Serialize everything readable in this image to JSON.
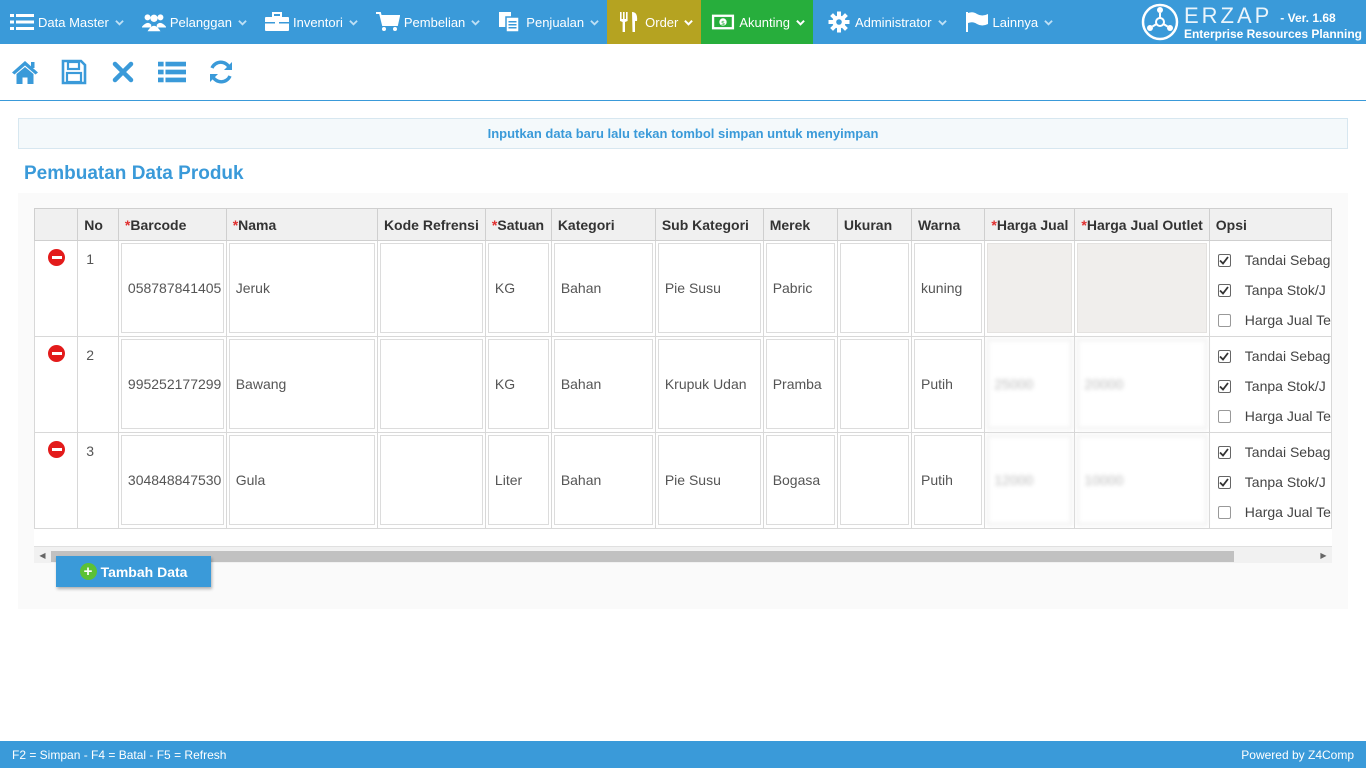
{
  "nav": {
    "items": [
      {
        "label": "Data Master",
        "icon": "list-icon"
      },
      {
        "label": "Pelanggan",
        "icon": "users-icon"
      },
      {
        "label": "Inventori",
        "icon": "briefcase-icon"
      },
      {
        "label": "Pembelian",
        "icon": "cart-icon"
      },
      {
        "label": "Penjualan",
        "icon": "documents-icon"
      },
      {
        "label": "Order",
        "icon": "utensils-icon"
      },
      {
        "label": "Akunting",
        "icon": "money-icon"
      },
      {
        "label": "Administrator",
        "icon": "gear-icon"
      },
      {
        "label": "Lainnya",
        "icon": "flag-icon"
      }
    ],
    "colors": {
      "bar": "#3a9ad9",
      "order": "#b5a321",
      "akunting": "#27ae3c"
    }
  },
  "brand": {
    "name": "ERZAP",
    "version": "- Ver. 1.68",
    "subtitle": "Enterprise Resources Planning"
  },
  "toolbar": {
    "buttons": [
      "home-icon",
      "save-icon",
      "close-icon",
      "list-icon",
      "refresh-icon"
    ]
  },
  "notice": "Inputkan data baru lalu tekan tombol simpan untuk menyimpan",
  "page_title": "Pembuatan Data Produk",
  "table": {
    "headers": {
      "no": "No",
      "barcode": "Barcode",
      "nama": "Nama",
      "kode_referensi": "Kode Refrensi",
      "satuan": "Satuan",
      "kategori": "Kategori",
      "sub_kategori": "Sub Kategori",
      "merek": "Merek",
      "ukuran": "Ukuran",
      "warna": "Warna",
      "harga_jual": "Harga Jual",
      "harga_jual_outlet": "Harga Jual Outlet",
      "opsi": "Opsi"
    },
    "required_mark": "*",
    "rows": [
      {
        "no": "1",
        "barcode": "058787841405",
        "nama": "Jeruk",
        "kode_referensi": "",
        "satuan": "KG",
        "kategori": "Bahan",
        "sub_kategori": "Pie Susu",
        "merek": "Pabric",
        "ukuran": "",
        "warna": "kuning",
        "harga_jual": "",
        "harga_jual_outlet": "",
        "opsi": [
          {
            "label": "Tandai Sebag",
            "checked": true
          },
          {
            "label": "Tanpa Stok/J",
            "checked": true
          },
          {
            "label": "Harga Jual Te",
            "checked": false
          }
        ]
      },
      {
        "no": "2",
        "barcode": "995252177299",
        "nama": "Bawang",
        "kode_referensi": "",
        "satuan": "KG",
        "kategori": "Bahan",
        "sub_kategori": "Krupuk Udan",
        "merek": "Pramba",
        "ukuran": "",
        "warna": "Putih",
        "harga_jual": "25000",
        "harga_jual_outlet": "20000",
        "opsi": [
          {
            "label": "Tandai Sebag",
            "checked": true
          },
          {
            "label": "Tanpa Stok/J",
            "checked": true
          },
          {
            "label": "Harga Jual Te",
            "checked": false
          }
        ]
      },
      {
        "no": "3",
        "barcode": "304848847530",
        "nama": "Gula",
        "kode_referensi": "",
        "satuan": "Liter",
        "kategori": "Bahan",
        "sub_kategori": "Pie Susu",
        "merek": "Bogasa",
        "ukuran": "",
        "warna": "Putih",
        "harga_jual": "12000",
        "harga_jual_outlet": "10000",
        "opsi": [
          {
            "label": "Tandai Sebag",
            "checked": true
          },
          {
            "label": "Tanpa Stok/J",
            "checked": true
          },
          {
            "label": "Harga Jual Te",
            "checked": false
          }
        ]
      }
    ]
  },
  "add_button": "Tambah Data",
  "footer": {
    "shortcuts": "F2 = Simpan - F4 = Batal - F5 = Refresh",
    "powered": "Powered by Z4Comp"
  }
}
